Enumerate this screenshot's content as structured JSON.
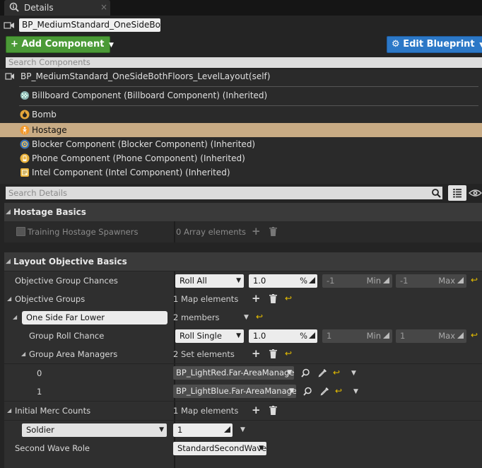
{
  "tab": {
    "label": "Details",
    "close": "×"
  },
  "header": {
    "name_value": "BP_MediumStandard_OneSideBothI",
    "add_component_label": "Add Component",
    "edit_blueprint_label": "Edit Blueprint",
    "search_components_placeholder": "Search Components"
  },
  "components": [
    {
      "label": "BP_MediumStandard_OneSideBothFloors_LevelLayout(self)",
      "icon": "blueprint-icon"
    },
    {
      "label": "Billboard Component (Billboard Component) (Inherited)",
      "icon": "billboard-icon"
    },
    {
      "label": "Bomb",
      "icon": "bomb-icon"
    },
    {
      "label": "Hostage",
      "icon": "hostage-icon"
    },
    {
      "label": "Blocker Component (Blocker Component) (Inherited)",
      "icon": "blocker-icon"
    },
    {
      "label": "Phone Component (Phone Component) (Inherited)",
      "icon": "phone-icon"
    },
    {
      "label": "Intel Component (Intel Component) (Inherited)",
      "icon": "intel-icon"
    }
  ],
  "details": {
    "search_placeholder": "Search Details",
    "hostage_basics": {
      "title": "Hostage Basics",
      "training_spawners_label": "Training Hostage Spawners",
      "training_spawners_value": "0 Array elements"
    },
    "layout_objective_basics": {
      "title": "Layout Objective Basics",
      "group_chances_label": "Objective Group Chances",
      "group_chances_mode": "Roll All",
      "group_chances_value": "1.0",
      "group_chances_suffix": "%",
      "group_chances_min": "-1",
      "group_chances_min_label": "Min",
      "group_chances_max": "-1",
      "group_chances_max_label": "Max",
      "objective_groups_label": "Objective Groups",
      "objective_groups_value": "1 Map elements",
      "group_key": "One Side Far Lower",
      "group_members": "2 members",
      "roll_chance_label": "Group Roll Chance",
      "roll_chance_mode": "Roll Single",
      "roll_chance_value": "1.0",
      "roll_chance_suffix": "%",
      "roll_chance_min": "1",
      "roll_chance_min_label": "Min",
      "roll_chance_max": "1",
      "roll_chance_max_label": "Max",
      "area_managers_label": "Group Area Managers",
      "area_managers_value": "2 Set elements",
      "manager_0_index": "0",
      "manager_0_value": "BP_LightRed.Far-AreaManager",
      "manager_1_index": "1",
      "manager_1_value": "BP_LightBlue.Far-AreaManager",
      "merc_counts_label": "Initial Merc Counts",
      "merc_counts_value": "1 Map elements",
      "merc_type": "Soldier",
      "merc_count": "1",
      "second_wave_label": "Second Wave Role",
      "second_wave_value": "StandardSecondWave"
    }
  },
  "colors": {
    "add_button": "#4b9a37",
    "edit_button": "#2c78c7",
    "selected_row": "#c8ab84",
    "reset_arrow": "#e9c000"
  }
}
